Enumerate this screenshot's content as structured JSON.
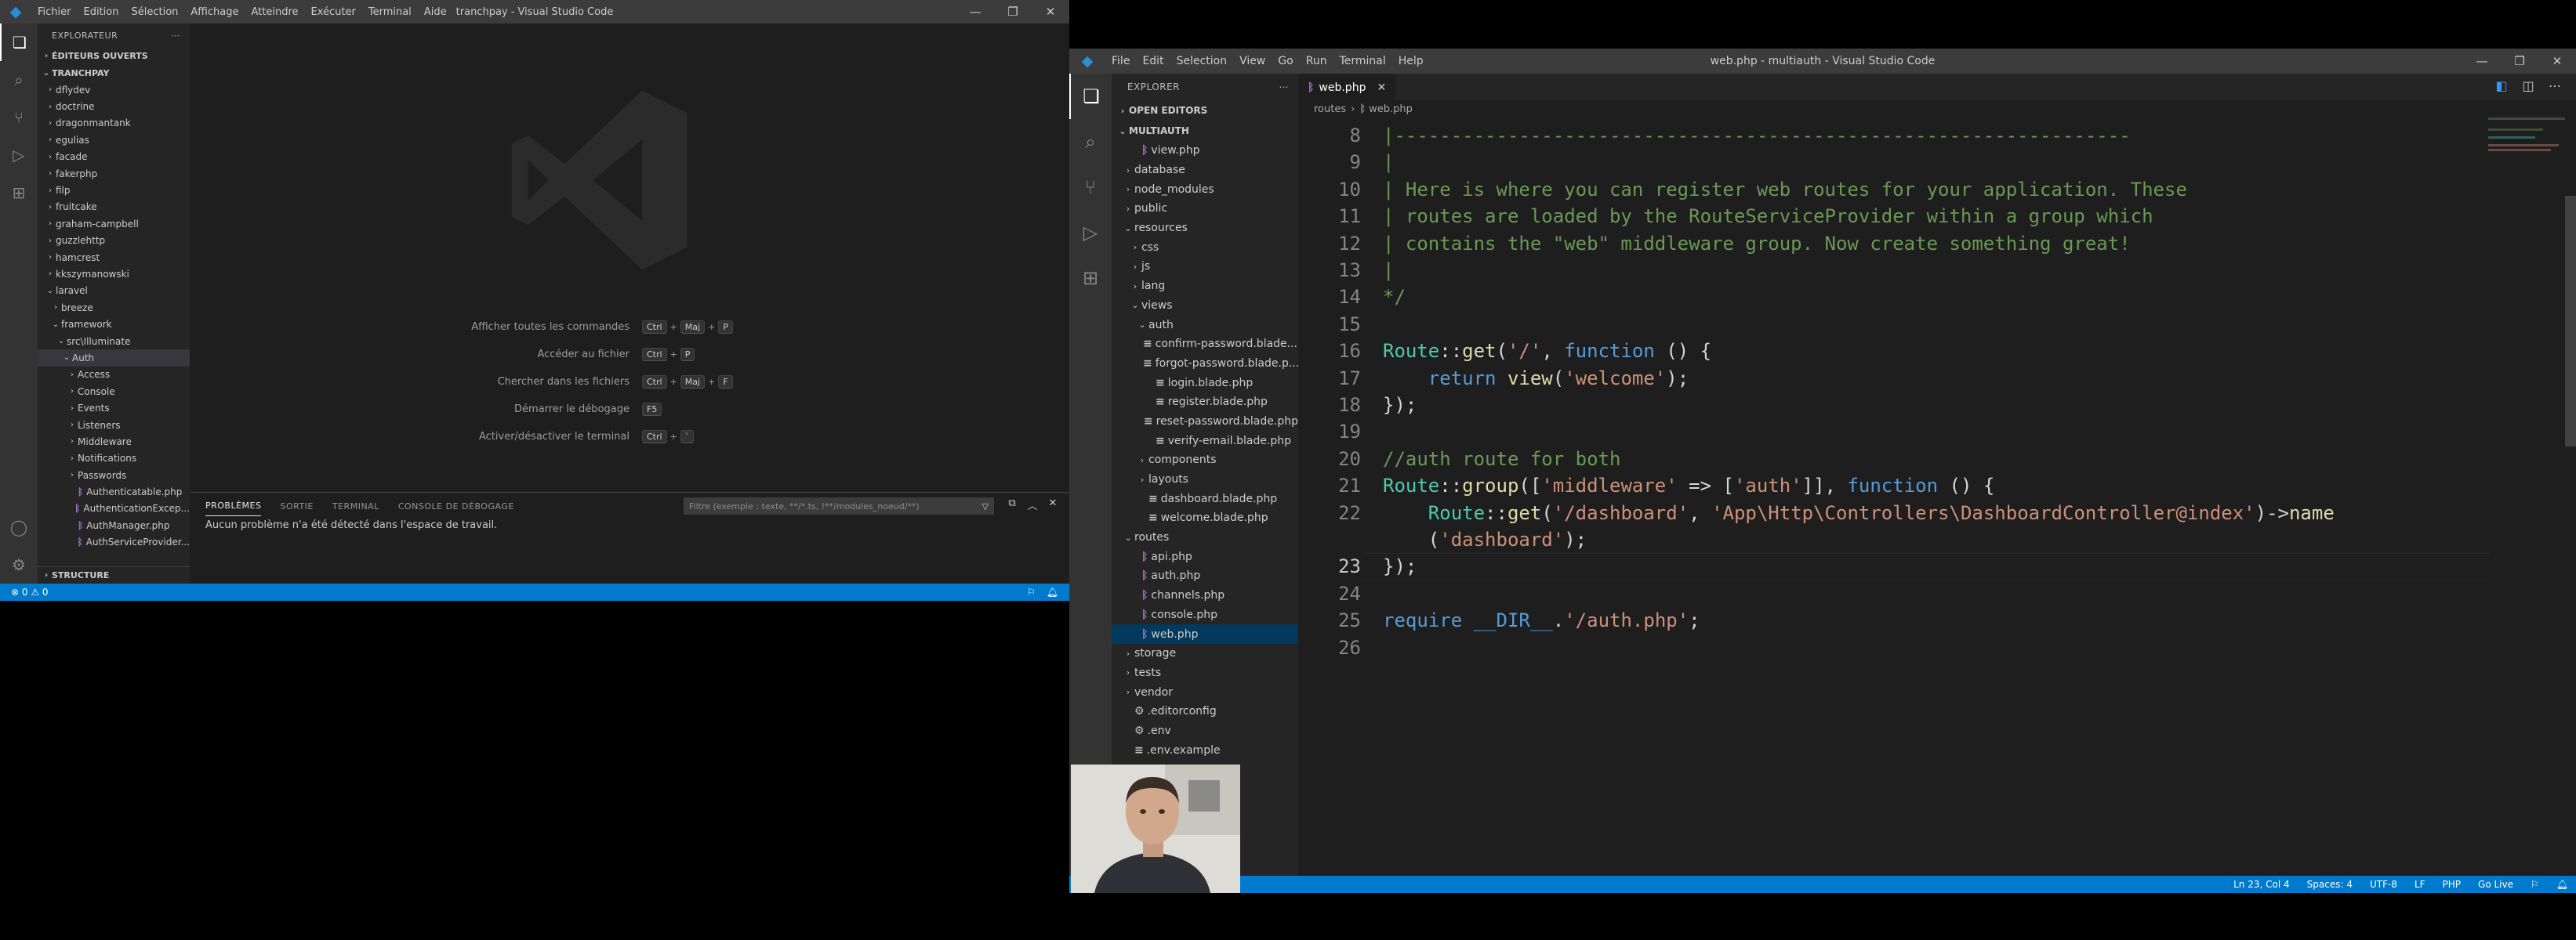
{
  "left_window": {
    "title": "tranchpay - Visual Studio Code",
    "menu": [
      "Fichier",
      "Edition",
      "Sélection",
      "Affichage",
      "Atteindre",
      "Exécuter",
      "Terminal",
      "Aide"
    ],
    "explorer_title": "EXPLORATEUR",
    "open_editors": "ÉDITEURS OUVERTS",
    "project": "TRANCHPAY",
    "tree": [
      {
        "label": "dflydev",
        "indent": 1,
        "kind": "folder"
      },
      {
        "label": "doctrine",
        "indent": 1,
        "kind": "folder"
      },
      {
        "label": "dragonmantank",
        "indent": 1,
        "kind": "folder"
      },
      {
        "label": "egulias",
        "indent": 1,
        "kind": "folder"
      },
      {
        "label": "facade",
        "indent": 1,
        "kind": "folder"
      },
      {
        "label": "fakerphp",
        "indent": 1,
        "kind": "folder"
      },
      {
        "label": "filp",
        "indent": 1,
        "kind": "folder"
      },
      {
        "label": "fruitcake",
        "indent": 1,
        "kind": "folder"
      },
      {
        "label": "graham-campbell",
        "indent": 1,
        "kind": "folder"
      },
      {
        "label": "guzzlehttp",
        "indent": 1,
        "kind": "folder"
      },
      {
        "label": "hamcrest",
        "indent": 1,
        "kind": "folder"
      },
      {
        "label": "kkszymanowski",
        "indent": 1,
        "kind": "folder"
      },
      {
        "label": "laravel",
        "indent": 1,
        "kind": "open"
      },
      {
        "label": "breeze",
        "indent": 2,
        "kind": "folder"
      },
      {
        "label": "framework",
        "indent": 2,
        "kind": "open"
      },
      {
        "label": "src\\Illuminate",
        "indent": 3,
        "kind": "open"
      },
      {
        "label": "Auth",
        "indent": 4,
        "kind": "open",
        "selected": true
      },
      {
        "label": "Access",
        "indent": 5,
        "kind": "folder"
      },
      {
        "label": "Console",
        "indent": 5,
        "kind": "folder"
      },
      {
        "label": "Events",
        "indent": 5,
        "kind": "folder"
      },
      {
        "label": "Listeners",
        "indent": 5,
        "kind": "folder"
      },
      {
        "label": "Middleware",
        "indent": 5,
        "kind": "folder"
      },
      {
        "label": "Notifications",
        "indent": 5,
        "kind": "folder"
      },
      {
        "label": "Passwords",
        "indent": 5,
        "kind": "folder"
      },
      {
        "label": "Authenticatable.php",
        "indent": 5,
        "kind": "php"
      },
      {
        "label": "AuthenticationExcep...",
        "indent": 5,
        "kind": "php"
      },
      {
        "label": "AuthManager.php",
        "indent": 5,
        "kind": "php"
      },
      {
        "label": "AuthServiceProvider...",
        "indent": 5,
        "kind": "php"
      }
    ],
    "outline": "STRUCTURE",
    "commands": [
      {
        "label": "Afficher toutes les commandes",
        "keys": [
          "Ctrl",
          "Maj",
          "P"
        ]
      },
      {
        "label": "Accéder au fichier",
        "keys": [
          "Ctrl",
          "P"
        ]
      },
      {
        "label": "Chercher dans les fichiers",
        "keys": [
          "Ctrl",
          "Maj",
          "F"
        ]
      },
      {
        "label": "Démarrer le débogage",
        "keys": [
          "F5"
        ]
      },
      {
        "label": "Activer/désactiver le terminal",
        "keys": [
          "Ctrl",
          "`"
        ]
      }
    ],
    "panel_tabs": [
      "PROBLÈMES",
      "SORTIE",
      "TERMINAL",
      "CONSOLE DE DÉBOGAGE"
    ],
    "filter_placeholder": "Filtre (exemple : texte, **/*.ts, !**/modules_noeud/**)",
    "panel_message": "Aucun problème n'a été détecté dans l'espace de travail.",
    "status": "⊗ 0 ⚠ 0"
  },
  "right_window": {
    "title": "web.php - multiauth - Visual Studio Code",
    "menu": [
      "File",
      "Edit",
      "Selection",
      "View",
      "Go",
      "Run",
      "Terminal",
      "Help"
    ],
    "explorer_title": "EXPLORER",
    "open_editors": "OPEN EDITORS",
    "project": "MULTIAUTH",
    "tree": [
      {
        "label": "view.php",
        "indent": 2,
        "kind": "php"
      },
      {
        "label": "database",
        "indent": 1,
        "kind": "folder"
      },
      {
        "label": "node_modules",
        "indent": 1,
        "kind": "folder"
      },
      {
        "label": "public",
        "indent": 1,
        "kind": "folder"
      },
      {
        "label": "resources",
        "indent": 1,
        "kind": "open"
      },
      {
        "label": "css",
        "indent": 2,
        "kind": "folder"
      },
      {
        "label": "js",
        "indent": 2,
        "kind": "folder"
      },
      {
        "label": "lang",
        "indent": 2,
        "kind": "folder"
      },
      {
        "label": "views",
        "indent": 2,
        "kind": "open"
      },
      {
        "label": "auth",
        "indent": 3,
        "kind": "open"
      },
      {
        "label": "confirm-password.blade....",
        "indent": 4,
        "kind": "blade"
      },
      {
        "label": "forgot-password.blade.p...",
        "indent": 4,
        "kind": "blade"
      },
      {
        "label": "login.blade.php",
        "indent": 4,
        "kind": "blade"
      },
      {
        "label": "register.blade.php",
        "indent": 4,
        "kind": "blade"
      },
      {
        "label": "reset-password.blade.php",
        "indent": 4,
        "kind": "blade"
      },
      {
        "label": "verify-email.blade.php",
        "indent": 4,
        "kind": "blade"
      },
      {
        "label": "components",
        "indent": 3,
        "kind": "folder"
      },
      {
        "label": "layouts",
        "indent": 3,
        "kind": "folder"
      },
      {
        "label": "dashboard.blade.php",
        "indent": 3,
        "kind": "blade"
      },
      {
        "label": "welcome.blade.php",
        "indent": 3,
        "kind": "blade"
      },
      {
        "label": "routes",
        "indent": 1,
        "kind": "open"
      },
      {
        "label": "api.php",
        "indent": 2,
        "kind": "php"
      },
      {
        "label": "auth.php",
        "indent": 2,
        "kind": "php"
      },
      {
        "label": "channels.php",
        "indent": 2,
        "kind": "php"
      },
      {
        "label": "console.php",
        "indent": 2,
        "kind": "php"
      },
      {
        "label": "web.php",
        "indent": 2,
        "kind": "php",
        "selected": true
      },
      {
        "label": "storage",
        "indent": 1,
        "kind": "folder"
      },
      {
        "label": "tests",
        "indent": 1,
        "kind": "folder"
      },
      {
        "label": "vendor",
        "indent": 1,
        "kind": "folder"
      },
      {
        "label": ".editorconfig",
        "indent": 1,
        "kind": "gear"
      },
      {
        "label": ".env",
        "indent": 1,
        "kind": "gear"
      },
      {
        "label": ".env.example",
        "indent": 1,
        "kind": "blade"
      }
    ],
    "tab": "web.php",
    "breadcrumb": [
      "routes",
      "web.php"
    ],
    "code": [
      {
        "n": "8",
        "t": [
          [
            "cm",
            "|-----------------------------------------------------------------"
          ]
        ]
      },
      {
        "n": "9",
        "t": [
          [
            "cm",
            "|"
          ]
        ]
      },
      {
        "n": "10",
        "t": [
          [
            "cm",
            "| Here is where you can register web routes for your application. These"
          ]
        ]
      },
      {
        "n": "11",
        "t": [
          [
            "cm",
            "| routes are loaded by the RouteServiceProvider within a group which"
          ]
        ]
      },
      {
        "n": "12",
        "t": [
          [
            "cm",
            "| contains the \"web\" middleware group. Now create something great!"
          ]
        ]
      },
      {
        "n": "13",
        "t": [
          [
            "cm",
            "|"
          ]
        ]
      },
      {
        "n": "14",
        "t": [
          [
            "cm",
            "*/"
          ]
        ]
      },
      {
        "n": "15",
        "t": []
      },
      {
        "n": "16",
        "t": [
          [
            "cl",
            "Route"
          ],
          [
            "pu",
            "::"
          ],
          [
            "fn",
            "get"
          ],
          [
            "pu",
            "("
          ],
          [
            "st",
            "'/'"
          ],
          [
            "pu",
            ", "
          ],
          [
            "kw",
            "function"
          ],
          [
            "pu",
            " () {"
          ]
        ]
      },
      {
        "n": "17",
        "t": [
          [
            "pu",
            "    "
          ],
          [
            "kw",
            "return"
          ],
          [
            "pu",
            " "
          ],
          [
            "fn",
            "view"
          ],
          [
            "pu",
            "("
          ],
          [
            "st",
            "'welcome'"
          ],
          [
            "pu",
            ");"
          ]
        ]
      },
      {
        "n": "18",
        "t": [
          [
            "pu",
            "});"
          ]
        ]
      },
      {
        "n": "19",
        "t": []
      },
      {
        "n": "20",
        "t": [
          [
            "cm",
            "//auth route for both"
          ]
        ]
      },
      {
        "n": "21",
        "t": [
          [
            "cl",
            "Route"
          ],
          [
            "pu",
            "::"
          ],
          [
            "fn",
            "group"
          ],
          [
            "pu",
            "(["
          ],
          [
            "st",
            "'middleware'"
          ],
          [
            "pu",
            " => ["
          ],
          [
            "st",
            "'auth'"
          ],
          [
            "pu",
            "]], "
          ],
          [
            "kw",
            "function"
          ],
          [
            "pu",
            " () {"
          ]
        ]
      },
      {
        "n": "22",
        "t": [
          [
            "pu",
            "    "
          ],
          [
            "cl",
            "Route"
          ],
          [
            "pu",
            "::"
          ],
          [
            "fn",
            "get"
          ],
          [
            "pu",
            "("
          ],
          [
            "st",
            "'/dashboard'"
          ],
          [
            "pu",
            ", "
          ],
          [
            "st",
            "'App\\Http\\Controllers\\DashboardController@index'"
          ],
          [
            "pu",
            ")->"
          ],
          [
            "fn",
            "name"
          ]
        ]
      },
      {
        "n": "",
        "t": [
          [
            "pu",
            "    ("
          ],
          [
            "st",
            "'dashboard'"
          ],
          [
            "pu",
            ");"
          ]
        ]
      },
      {
        "n": "23",
        "t": [
          [
            "pu",
            "});"
          ]
        ],
        "cur": true
      },
      {
        "n": "24",
        "t": []
      },
      {
        "n": "25",
        "t": [
          [
            "kw",
            "require"
          ],
          [
            "pu",
            " "
          ],
          [
            "kw",
            "__DIR__"
          ],
          [
            "pu",
            "."
          ],
          [
            "st",
            "'/auth.php'"
          ],
          [
            "pu",
            ";"
          ]
        ]
      },
      {
        "n": "26",
        "t": []
      }
    ],
    "status": [
      "Ln 23, Col 4",
      "Spaces: 4",
      "UTF-8",
      "LF",
      "PHP",
      "Go Live"
    ]
  },
  "colors": {
    "accent": "#007acc",
    "comment": "#6a9955",
    "keyword": "#569cd6",
    "string": "#ce9178",
    "class": "#4ec9b0",
    "function": "#dcdcaa"
  }
}
